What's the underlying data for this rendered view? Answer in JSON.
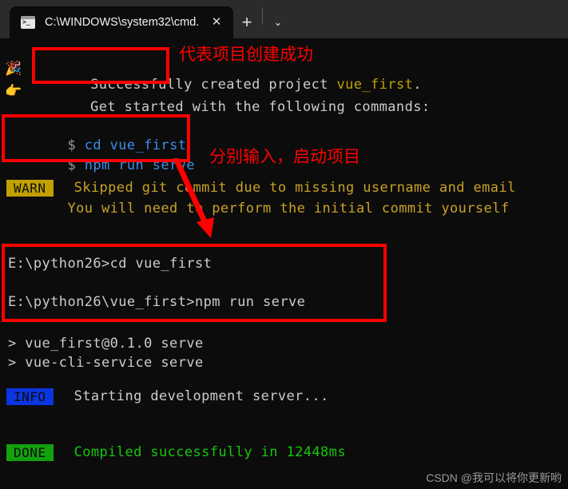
{
  "window": {
    "tab": {
      "icon": "terminal-icon",
      "title": "C:\\WINDOWS\\system32\\cmd.",
      "close_label": "✕"
    },
    "new_tab_label": "+",
    "dropdown_label": "⌄"
  },
  "terminal": {
    "lines": [
      {
        "id": "success-line",
        "emoji": "🎉",
        "segments": [
          {
            "text": "  Successfully created project ",
            "color": "#cccccc"
          },
          {
            "text": "vue_first",
            "color": "#c1a000"
          },
          {
            "text": ".",
            "color": "#cccccc"
          }
        ]
      },
      {
        "id": "get-started-line",
        "emoji": "👉",
        "segments": [
          {
            "text": "  Get started with the following commands:",
            "color": "#cccccc"
          }
        ]
      },
      {
        "id": "cmd-cd-line",
        "segments": [
          {
            "text": " $ ",
            "color": "#9a9a9a"
          },
          {
            "text": "cd vue_first",
            "color": "#3b8eea"
          }
        ]
      },
      {
        "id": "cmd-npm-line",
        "segments": [
          {
            "text": " $ ",
            "color": "#9a9a9a"
          },
          {
            "text": "npm run serve",
            "color": "#3b8eea"
          }
        ]
      },
      {
        "id": "warn-line-1",
        "segments": [
          {
            "text": " Skipped git commit due to missing username and email",
            "color": "#c1a000"
          }
        ]
      },
      {
        "id": "warn-line-2",
        "segments": [
          {
            "text": "       You will need to perform the initial commit yourself",
            "color": "#c1a000"
          }
        ]
      },
      {
        "id": "prompt-cd-line",
        "segments": [
          {
            "text": "E:\\python26>cd vue_first",
            "color": "#cccccc"
          }
        ]
      },
      {
        "id": "prompt-npm-line",
        "segments": [
          {
            "text": "E:\\python26\\vue_first>npm run serve",
            "color": "#cccccc"
          }
        ]
      },
      {
        "id": "npm-script-line",
        "segments": [
          {
            "text": "> vue_first@0.1.0 serve",
            "color": "#cccccc"
          }
        ]
      },
      {
        "id": "npm-exec-line",
        "segments": [
          {
            "text": "> vue-cli-service serve",
            "color": "#cccccc"
          }
        ]
      },
      {
        "id": "info-line",
        "segments": [
          {
            "text": " Starting development server...",
            "color": "#cccccc"
          }
        ]
      },
      {
        "id": "done-line",
        "segments": [
          {
            "text": " Compiled successfully in 12448ms",
            "color": "#16c60c"
          }
        ]
      }
    ],
    "badges": {
      "warn": "WARN",
      "info": "INFO",
      "done": "DONE"
    }
  },
  "annotations": {
    "accent_color": "#ff0000",
    "note_success": "代表项目创建成功",
    "note_commands": "分别输入，启动项目",
    "box_success_label": "highlight-successfully",
    "box_commands_label": "highlight-start-commands",
    "box_prompt_label": "highlight-executed-commands",
    "arrow_label": "red-down-arrow"
  },
  "watermark": "CSDN @我可以将你更新哟"
}
